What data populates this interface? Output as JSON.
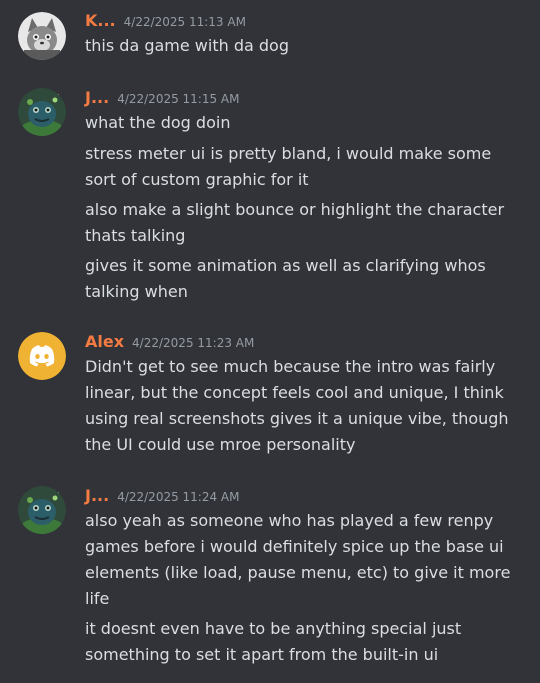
{
  "colors": {
    "background": "#313338",
    "username": "#f47b42",
    "timestamp": "#949ba4",
    "message_text": "#dbdee1",
    "discord_avatar_bg": "#f0b232"
  },
  "messages": [
    {
      "author": "K...",
      "timestamp": "4/22/2025 11:13 AM",
      "avatar_icon": "gray-cat-avatar",
      "lines": [
        "this da game with da dog"
      ]
    },
    {
      "author": "J...",
      "timestamp": "4/22/2025 11:15 AM",
      "avatar_icon": "green-frog-avatar",
      "lines": [
        "what the dog doin",
        "stress meter ui is pretty bland, i would make some",
        "sort of custom graphic for it",
        "also make a slight bounce or highlight the character",
        "thats talking",
        "gives it some animation as well as clarifying whos",
        "talking when"
      ]
    },
    {
      "author": "Alex",
      "timestamp": "4/22/2025 11:23 AM",
      "avatar_icon": "discord-logo-avatar",
      "lines": [
        "Didn't get to see much because the intro was fairly",
        "linear, but the concept feels cool and unique, I think",
        "using real screenshots gives it a unique vibe, though",
        "the UI could use mroe personality"
      ]
    },
    {
      "author": "J...",
      "timestamp": "4/22/2025 11:24 AM",
      "avatar_icon": "green-frog-avatar",
      "lines": [
        "also yeah as someone who has played a few renpy",
        "games before i would definitely spice up the base ui",
        "elements (like load, pause menu, etc) to give it more",
        "life",
        "it doesnt even have to be anything special just",
        "something to set it apart from the built-in ui"
      ]
    }
  ]
}
